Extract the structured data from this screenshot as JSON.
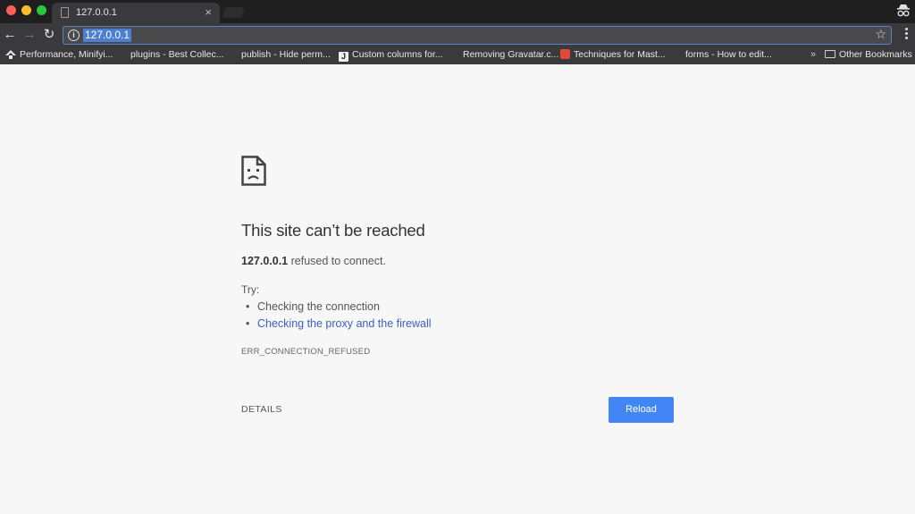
{
  "tab": {
    "title": "127.0.0.1",
    "close": "×"
  },
  "toolbar": {
    "url": "127.0.0.1",
    "info_glyph": "i",
    "back_glyph": "←",
    "forward_glyph": "→",
    "reload_glyph": "↻",
    "star_glyph": "☆"
  },
  "bookmarks": {
    "items": [
      {
        "label": "Performance, Minifyi...",
        "icon": "wordpress-icon"
      },
      {
        "label": "plugins - Best Collec...",
        "icon": "none"
      },
      {
        "label": "publish - Hide perm...",
        "icon": "none"
      },
      {
        "label": "Custom columns for...",
        "icon": "j-icon"
      },
      {
        "label": "Removing Gravatar.c...",
        "icon": "none"
      },
      {
        "label": "Techniques for Mast...",
        "icon": "red-cross-icon"
      },
      {
        "label": "forms - How to edit...",
        "icon": "none"
      }
    ],
    "overflow": "»",
    "other": "Other Bookmarks",
    "j_glyph": "J"
  },
  "error": {
    "heading": "This site can’t be reached",
    "host": "127.0.0.1",
    "refused_text": " refused to connect.",
    "try_label": "Try:",
    "suggestions": [
      "Checking the connection",
      "Checking the proxy and the firewall"
    ],
    "code": "ERR_CONNECTION_REFUSED",
    "details_label": "DETAILS",
    "reload_label": "Reload"
  },
  "colors": {
    "accent": "#4285f4",
    "link": "#3d5fc4",
    "chrome_dark": "#3a3a3c"
  }
}
